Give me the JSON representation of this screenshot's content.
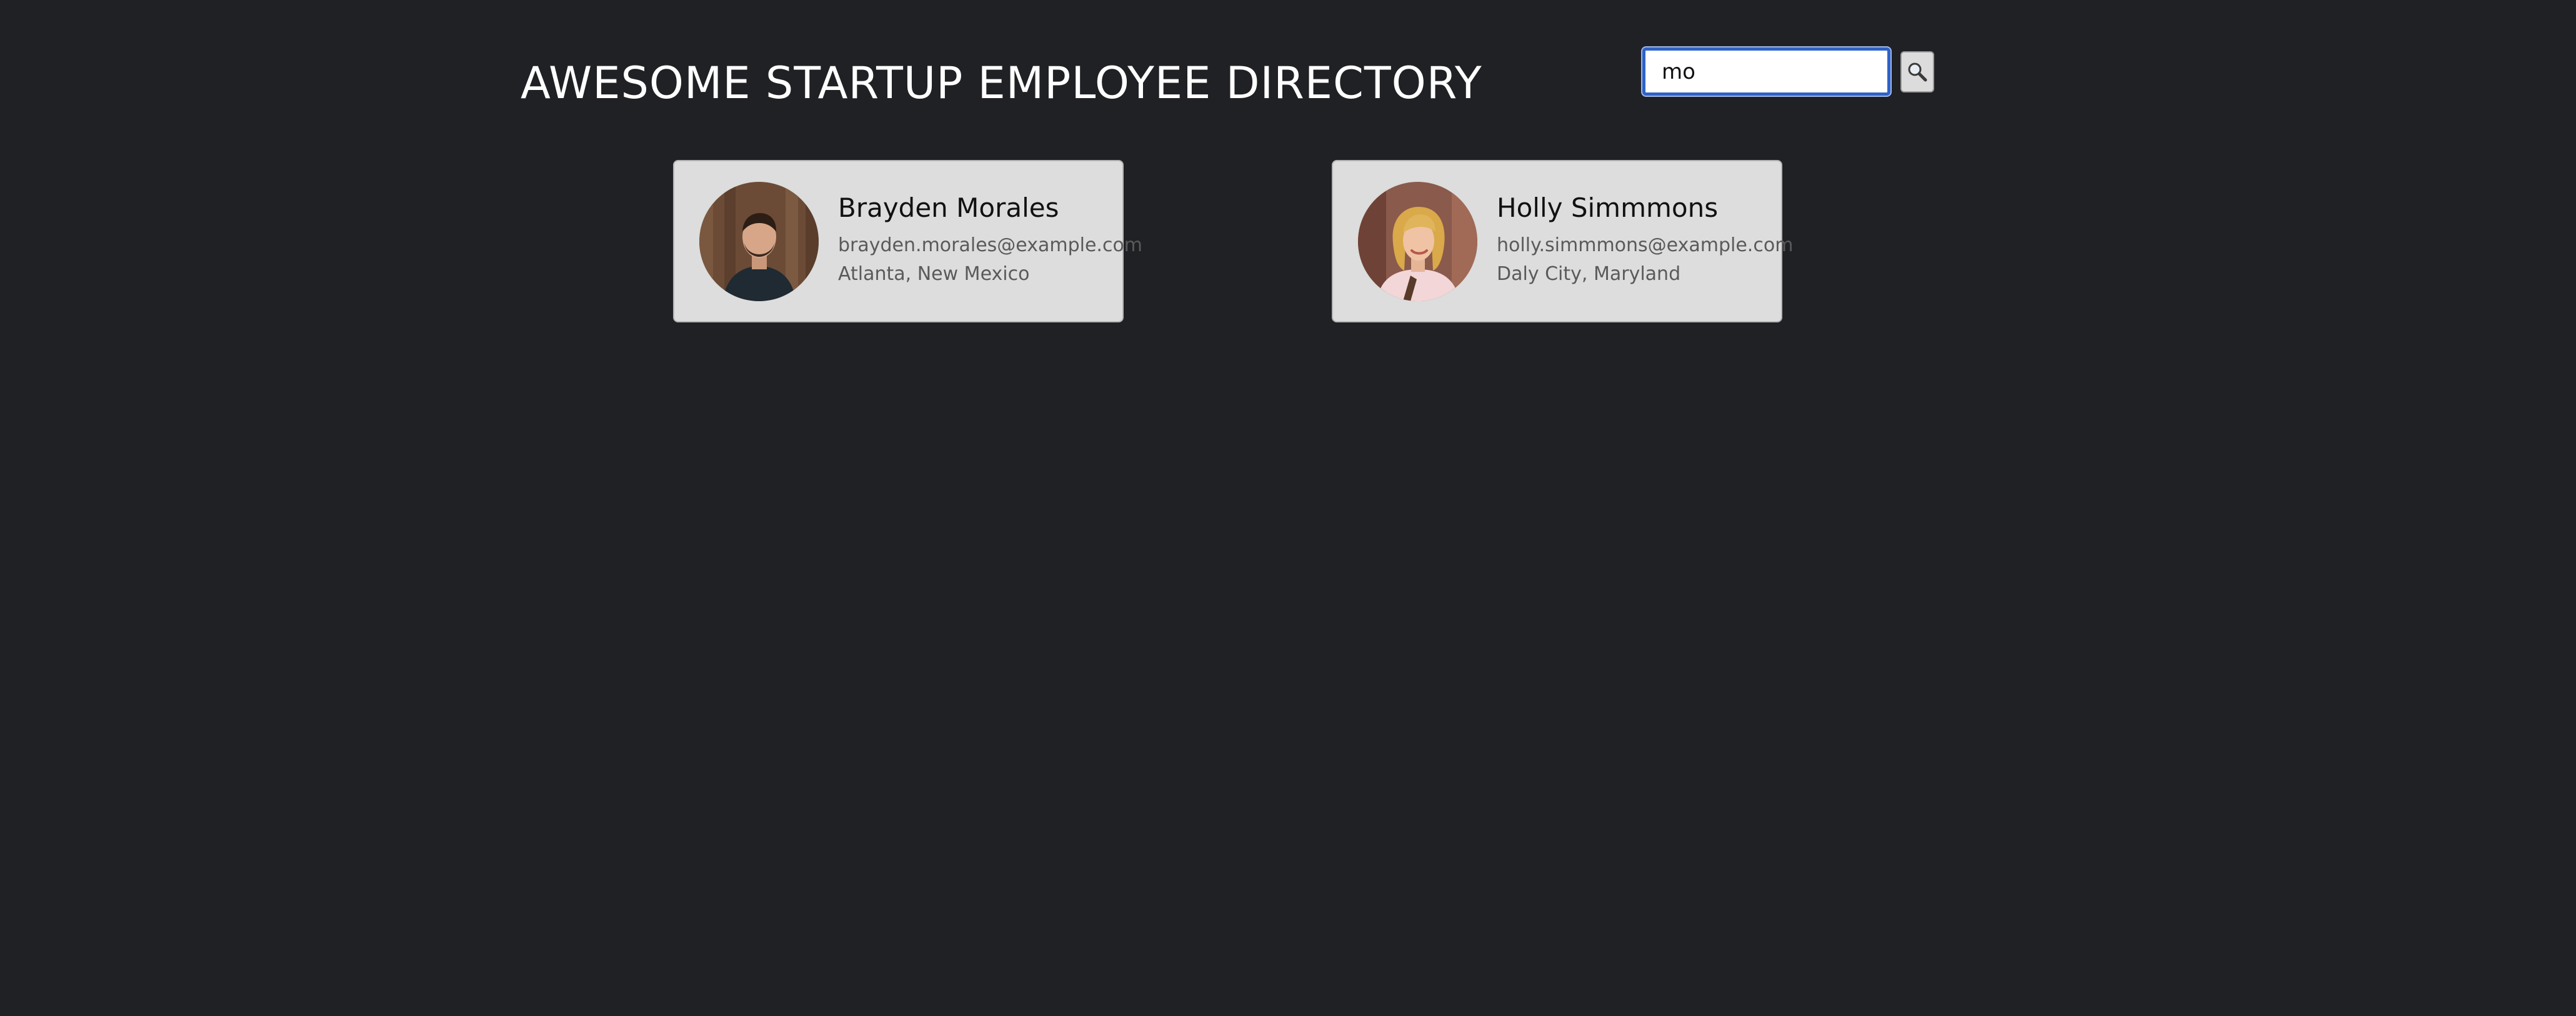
{
  "header": {
    "title": "AWESOME STARTUP EMPLOYEE DIRECTORY"
  },
  "search": {
    "value": "mo",
    "button_icon": "magnifying-glass-icon"
  },
  "employees": [
    {
      "name": "Brayden Morales",
      "email": "brayden.morales@example.com",
      "location": "Atlanta, New Mexico"
    },
    {
      "name": "Holly Simmmons",
      "email": "holly.simmmons@example.com",
      "location": "Daly City, Maryland"
    }
  ],
  "colors": {
    "page_background": "#202124",
    "card_background": "#dcdddc",
    "search_focus": "#2f62c7"
  }
}
